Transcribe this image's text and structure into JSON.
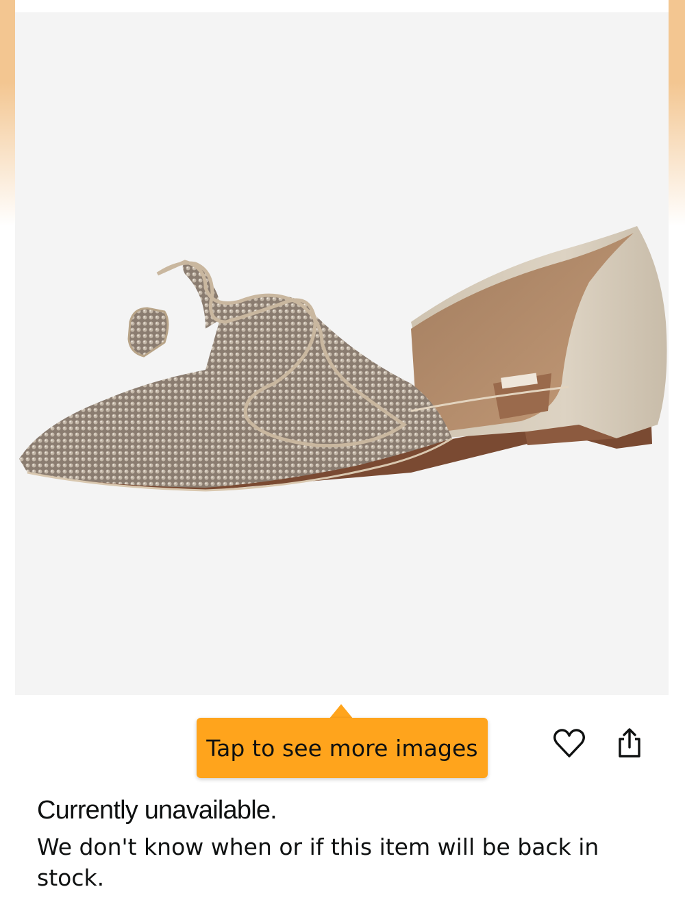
{
  "product_image": {
    "icon": "shoe-image",
    "alt": "Jeweled pointed-toe d'Orsay flat with bow"
  },
  "tooltip": {
    "label": "Tap to see more images",
    "color": "#ffa41c"
  },
  "actions": {
    "wishlist_icon": "heart-icon",
    "share_icon": "share-icon"
  },
  "availability": {
    "status": "Currently unavailable.",
    "detail": "We don't know when or if this item will be back in stock."
  }
}
